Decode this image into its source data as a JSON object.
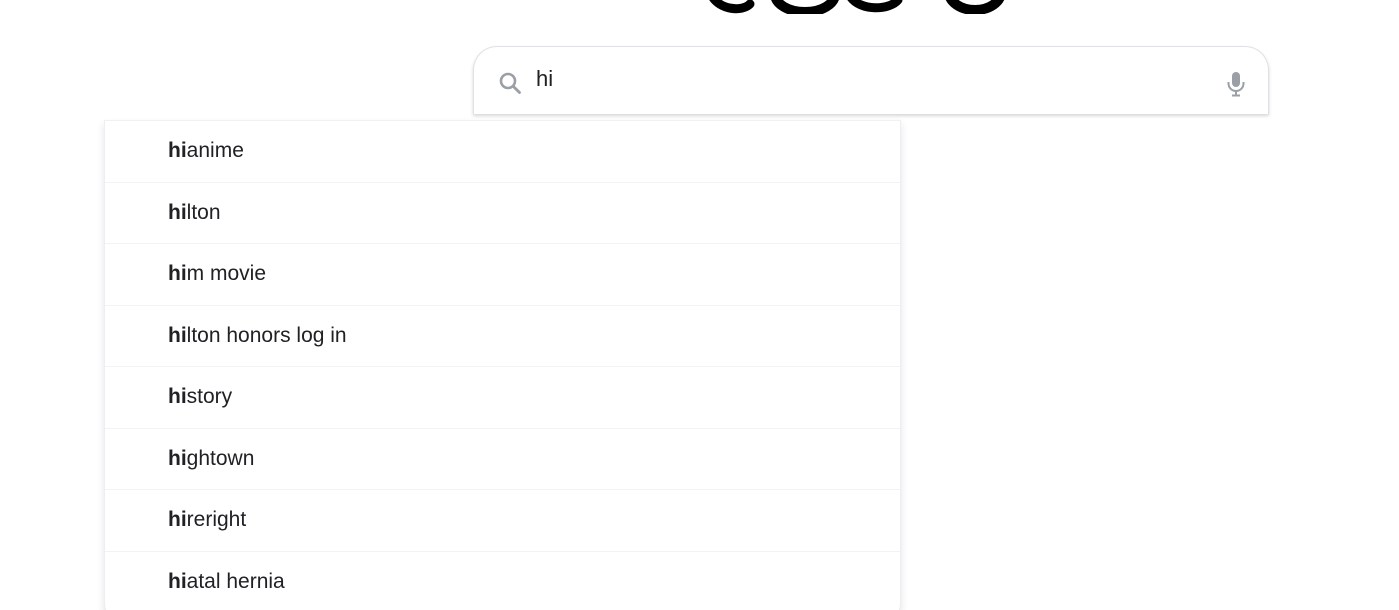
{
  "search": {
    "query": "hi",
    "placeholder": ""
  },
  "icons": {
    "search": "search-icon",
    "mic": "microphone-icon"
  },
  "colors": {
    "icon_gray": "#9aa0a6",
    "text": "#202124",
    "border": "#dfe1e5"
  },
  "suggestions": [
    {
      "match": "hi",
      "rest": "anime"
    },
    {
      "match": "hi",
      "rest": "lton"
    },
    {
      "match": "hi",
      "rest": "m movie"
    },
    {
      "match": "hi",
      "rest": "lton honors log in"
    },
    {
      "match": "hi",
      "rest": "story"
    },
    {
      "match": "hi",
      "rest": "ghtown"
    },
    {
      "match": "hi",
      "rest": "reright"
    },
    {
      "match": "hi",
      "rest": "atal hernia"
    }
  ]
}
